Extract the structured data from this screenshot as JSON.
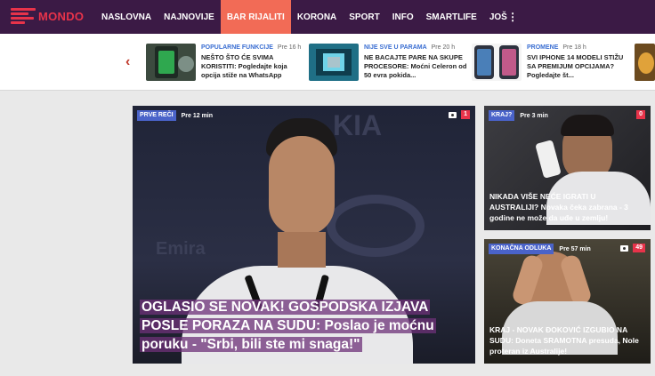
{
  "brand": {
    "name": "MONDO",
    "color": "#e8334a",
    "nav_bg": "#3b1a45"
  },
  "nav": {
    "items": [
      {
        "label": "NASLOVNA",
        "active": false
      },
      {
        "label": "NAJNOVIJE",
        "active": false
      },
      {
        "label": "BAR RIJALITI",
        "active": true
      },
      {
        "label": "KORONA",
        "active": false
      },
      {
        "label": "SPORT",
        "active": false
      },
      {
        "label": "INFO",
        "active": false
      },
      {
        "label": "SMARTLIFE",
        "active": false
      },
      {
        "label": "JOŠ",
        "active": false
      }
    ],
    "more_icon": "vertical-dots-icon"
  },
  "ticker": {
    "prev_icon": "chevron-left-icon",
    "items": [
      {
        "category": "POPULARNE FUNKCIJE",
        "time": "Pre 16 h",
        "title": "NEŠTO ŠTO ĆE SVIMA KORISTITI: Pogledajte koja opcija stiže na WhatsApp"
      },
      {
        "category": "NIJE SVE U PARAMA",
        "time": "Pre 20 h",
        "title": "NE BACAJTE PARE NA SKUPE PROCESORE: Moćni Celeron od 50 evra pokida..."
      },
      {
        "category": "PROMENE",
        "time": "Pre 18 h",
        "title": "SVI IPHONE 14 MODELI STIŽU SA PREMIJUM OPCIJAMA? Pogledajte št..."
      }
    ]
  },
  "main_story": {
    "badge": "PRVE REČI",
    "time": "Pre 12 min",
    "count": "1",
    "title": "OGLASIO SE NOVAK! GOSPODSKA IZJAVA POSLE PORAZA NA SUDU: Poslao je moćnu poruku - \"Srbi, bili ste mi snaga!\""
  },
  "side_stories": [
    {
      "badge": "KRAJ?",
      "time": "Pre 3 min",
      "count": "0",
      "title": "NIKADA VIŠE NEĆE IGRATI U AUSTRALIJI? Novaka čeka zabrana - 3 godine ne može da uđe u zemlju!"
    },
    {
      "badge": "KONAČNA ODLUKA",
      "time": "Pre 57 min",
      "count": "49",
      "title": "KRAJ - NOVAK ĐOKOVIĆ IZGUBIO NA SUDU: Doneta SRAMOTNA presuda, Nole proteran iz Australije!"
    }
  ]
}
